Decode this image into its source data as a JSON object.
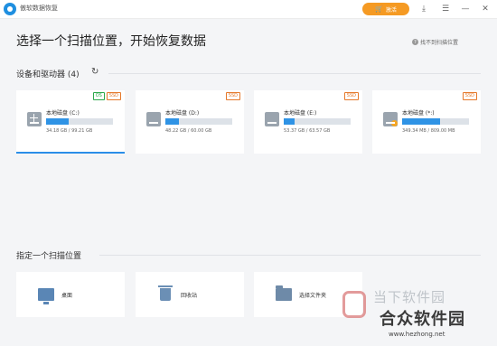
{
  "app": {
    "title": "傲软数据恢复"
  },
  "titlebar": {
    "upgrade_label": "激活",
    "upgrade_icon": "cart-icon",
    "download_icon": "download-icon",
    "menu_icon": "menu-icon",
    "minimize_icon": "minimize-icon",
    "close_icon": "close-icon"
  },
  "heading": "选择一个扫描位置，开始恢复数据",
  "help_link": "找不到扫描位置",
  "devices_section": {
    "title": "设备和驱动器 (4)"
  },
  "drives": [
    {
      "name": "本地磁盘 (C:)",
      "size": "34.18 GB / 99.21 GB",
      "fill": 0.34,
      "os": true,
      "os_label": "OS",
      "ssd_label": "SSD",
      "selected": true
    },
    {
      "name": "本地磁盘 (D:)",
      "size": "48.22 GB / 60.00 GB",
      "fill": 0.2,
      "os": false,
      "ssd_label": "SSD",
      "selected": false
    },
    {
      "name": "本地磁盘 (E:)",
      "size": "53.37 GB / 63.57 GB",
      "fill": 0.16,
      "os": false,
      "ssd_label": "SSD",
      "selected": false
    },
    {
      "name": "本地磁盘 (*:)",
      "size": "349.34 MB / 809.00 MB",
      "fill": 0.57,
      "os": false,
      "ssd_label": "SSD",
      "selected": false
    }
  ],
  "locations_section": {
    "title": "指定一个扫描位置"
  },
  "locations": [
    {
      "label": "桌面",
      "icon": "desktop-icon"
    },
    {
      "label": "回收站",
      "icon": "recycle-bin-icon"
    },
    {
      "label": "选择文件夹",
      "icon": "folder-icon"
    }
  ],
  "watermark": {
    "line1": "当下软件园",
    "line2": "合众软件园",
    "url": "www.hezhong.net"
  },
  "colors": {
    "accent": "#2f93e5",
    "upgrade": "#f59a23",
    "os_badge": "#2aa84a",
    "ssd_badge": "#e5782a"
  }
}
